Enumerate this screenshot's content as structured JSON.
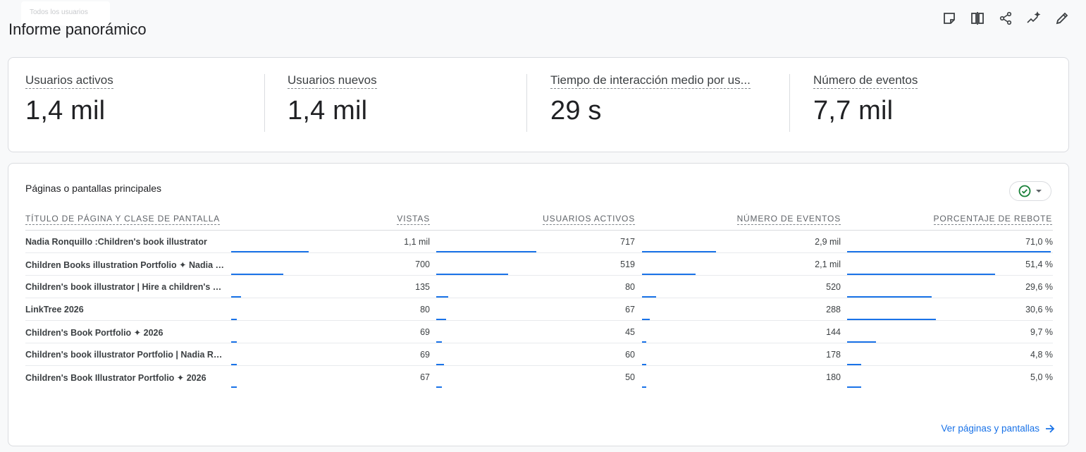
{
  "header": {
    "ghost_text": "Todos los usuarios",
    "title": "Informe panorámico",
    "tools": [
      "note-icon",
      "compare-columns-icon",
      "share-icon",
      "insights-icon",
      "edit-icon"
    ]
  },
  "kpis": [
    {
      "label": "Usuarios activos",
      "value": "1,4 mil"
    },
    {
      "label": "Usuarios nuevos",
      "value": "1,4 mil"
    },
    {
      "label": "Tiempo de interacción medio por us...",
      "value": "29 s"
    },
    {
      "label": "Número de eventos",
      "value": "7,7 mil"
    }
  ],
  "table": {
    "title": "Páginas o pantallas principales",
    "columns": [
      "TÍTULO DE PÁGINA Y CLASE DE PANTALLA",
      "VISTAS",
      "USUARIOS ACTIVOS",
      "NÚMERO DE EVENTOS",
      "PORCENTAJE DE REBOTE"
    ],
    "rows": [
      {
        "title": "Nadia Ronquillo :Children's book illustrator",
        "views": "1,1 mil",
        "users": "717",
        "events": "2,9 mil",
        "bounce": "71,0 %",
        "bars": [
          0.39,
          0.5,
          0.37,
          0.99
        ]
      },
      {
        "title": "Children Books illustration Portfolio ✦ Nadia R...",
        "views": "700",
        "users": "519",
        "events": "2,1 mil",
        "bounce": "51,4 %",
        "bars": [
          0.26,
          0.36,
          0.27,
          0.72
        ]
      },
      {
        "title": "Children's book illustrator | Hire a children's bo...",
        "views": "135",
        "users": "80",
        "events": "520",
        "bounce": "29,6 %",
        "bars": [
          0.05,
          0.06,
          0.07,
          0.41
        ]
      },
      {
        "title": "LinkTree 2026",
        "views": "80",
        "users": "67",
        "events": "288",
        "bounce": "30,6 %",
        "bars": [
          0.03,
          0.05,
          0.04,
          0.43
        ]
      },
      {
        "title": "Children's Book Portfolio ✦ 2026",
        "views": "69",
        "users": "45",
        "events": "144",
        "bounce": "9,7 %",
        "bars": [
          0.03,
          0.03,
          0.02,
          0.14
        ]
      },
      {
        "title": "Children's book illustrator Portfolio | Nadia Ron...",
        "views": "69",
        "users": "60",
        "events": "178",
        "bounce": "4,8 %",
        "bars": [
          0.03,
          0.04,
          0.02,
          0.07
        ]
      },
      {
        "title": "Children's Book Illustrator Portfolio ✦ 2026",
        "views": "67",
        "users": "50",
        "events": "180",
        "bounce": "5,0 %",
        "bars": [
          0.03,
          0.03,
          0.02,
          0.07
        ]
      }
    ],
    "footer_link": "Ver páginas y pantallas"
  },
  "colors": {
    "accent": "#1a73e8",
    "check": "#188038"
  }
}
